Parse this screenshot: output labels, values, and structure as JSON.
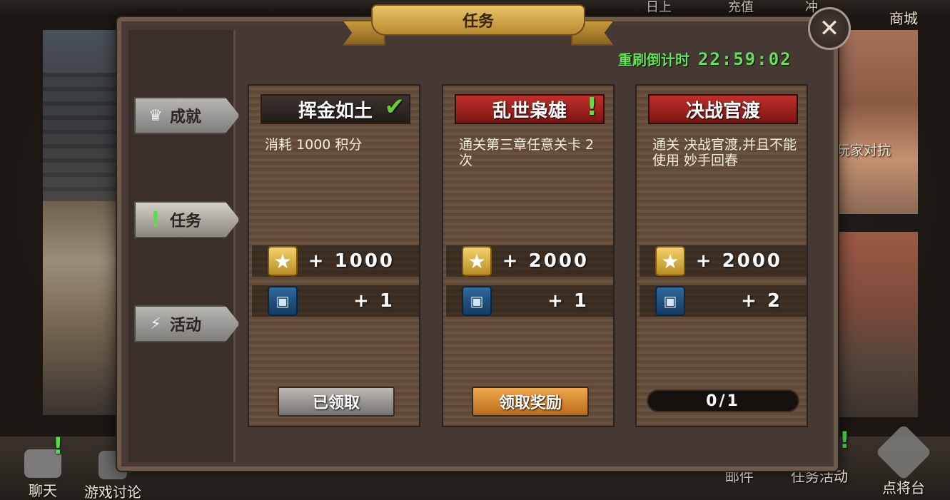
{
  "top_nav": {
    "ghost_items": [
      "日上",
      "充值",
      "冲"
    ],
    "mall_label": "商城"
  },
  "background": {
    "right_label": "玩家对抗"
  },
  "bottom_nav": {
    "chat_label": "聊天",
    "discuss_label": "游戏讨论",
    "mail_label": "邮件",
    "task_activity_label": "任务活动",
    "general_label": "点将台"
  },
  "dialog": {
    "title": "任务",
    "close_icon": "close-icon",
    "timer": {
      "label": "重刷倒计时",
      "value": "22:59:02"
    },
    "tabs": [
      {
        "label": "成就",
        "icon": "crown-icon"
      },
      {
        "label": "任务",
        "icon": "quest-icon",
        "alert": "!"
      },
      {
        "label": "活动",
        "icon": "lightning-icon"
      }
    ],
    "cards": [
      {
        "title": "挥金如土",
        "status_mark": "✔",
        "description": "消耗 1000 积分",
        "rewards": [
          {
            "icon": "star-icon",
            "value": "+ 1000"
          },
          {
            "icon": "card-icon",
            "value": "+ 1"
          }
        ],
        "action": "已领取"
      },
      {
        "title": "乱世枭雄",
        "status_mark": "!",
        "description": "通关第三章任意关卡 2 次",
        "rewards": [
          {
            "icon": "star-icon",
            "value": "+ 2000"
          },
          {
            "icon": "card-icon",
            "value": "+ 1"
          }
        ],
        "action": "领取奖励"
      },
      {
        "title": "决战官渡",
        "description": "通关 决战官渡,并且不能使用 妙手回春",
        "rewards": [
          {
            "icon": "star-icon",
            "value": "+ 2000"
          },
          {
            "icon": "card-icon",
            "value": "+ 2"
          }
        ],
        "progress": "0/1",
        "progress_fraction": 0
      }
    ]
  },
  "colors": {
    "timer_green": "#66e05a",
    "header_red": "#c12f2a",
    "claim_orange": "#f0a94b"
  }
}
